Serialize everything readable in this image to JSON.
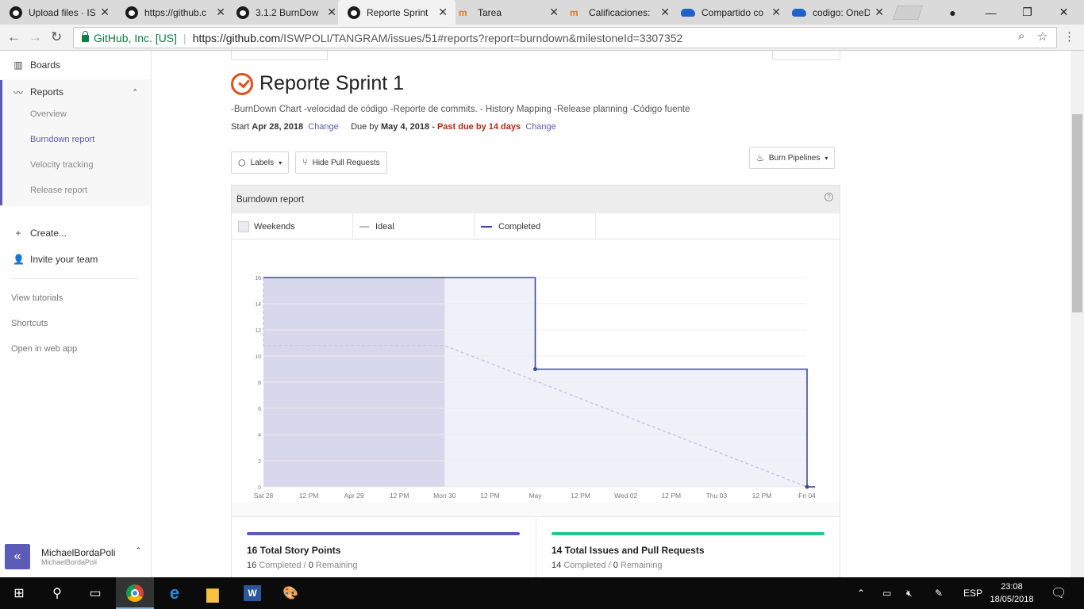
{
  "browser": {
    "tabs": [
      {
        "icon": "github",
        "title": "Upload files · IS"
      },
      {
        "icon": "github",
        "title": "https://github.c"
      },
      {
        "icon": "github",
        "title": "3.1.2 BurnDow"
      },
      {
        "icon": "github",
        "title": "Reporte Sprint",
        "active": true
      },
      {
        "icon": "moodle",
        "title": "Tarea"
      },
      {
        "icon": "moodle",
        "title": "Calificaciones: "
      },
      {
        "icon": "onedrive",
        "title": "Compartido co"
      },
      {
        "icon": "onedrive",
        "title": "codigo: OneDri"
      }
    ],
    "security_label": "GitHub, Inc. [US]",
    "url_host": "https://github.com",
    "url_rest": "/ISWPOLI/TANGRAM/issues/51#reports?report=burndown&milestoneId=3307352"
  },
  "sidebar": {
    "boards": "Boards",
    "reports": "Reports",
    "report_items": [
      "Overview",
      "Burndown report",
      "Velocity tracking",
      "Release report"
    ],
    "create": "Create...",
    "invite": "Invite your team",
    "links": [
      "View tutorials",
      "Shortcuts",
      "Open in web app"
    ],
    "user_name": "MichaelBordaPoli",
    "user_handle": "MichaelBordaPoli",
    "collapse_glyph": "«"
  },
  "main": {
    "title": "Reporte Sprint 1",
    "description": "-BurnDown Chart  -velocidad de código  -Reporte de commits.  - History Mapping   -Release planning  -Código fuente",
    "start_label": "Start",
    "start_date": "Apr 28, 2018",
    "change_label": "Change",
    "due_label": "Due by",
    "due_date": "May 4, 2018",
    "past_due": "Past due by 14 days",
    "dash": "-",
    "labels_button": "Labels",
    "hide_prs_button": "Hide Pull Requests",
    "burn_pipelines_button": "Burn Pipelines",
    "report_title": "Burndown report",
    "help_glyph": "?",
    "legend": {
      "weekends": "Weekends",
      "ideal": "Ideal",
      "completed": "Completed"
    },
    "stats": [
      {
        "big": "16 Total Story Points",
        "completed": "16",
        "completed_label": "Completed",
        "sep": " / ",
        "remaining": "0",
        "remaining_label": "Remaining",
        "color": "#5b5bb8"
      },
      {
        "big": "14 Total Issues and Pull Requests",
        "completed": "14",
        "completed_label": "Completed",
        "sep": " / ",
        "remaining": "0",
        "remaining_label": "Remaining",
        "color": "#1fc98a"
      }
    ]
  },
  "chart_data": {
    "type": "line",
    "title": "",
    "xlabel": "",
    "ylabel": "",
    "x_ticks": [
      "Sat 28",
      "12 PM",
      "Apr 29",
      "12 PM",
      "Mon 30",
      "12 PM",
      "May",
      "12 PM",
      "Wed 02",
      "12 PM",
      "Thu 03",
      "12 PM",
      "Fri 04"
    ],
    "y_ticks": [
      0,
      2,
      4,
      6,
      8,
      10,
      12,
      14,
      16
    ],
    "ylim": [
      0,
      16
    ],
    "x_unit": "hours since Apr 28, 2018 00:00",
    "xlim": [
      0,
      144
    ],
    "weekend_shading": [
      0,
      48
    ],
    "series": [
      {
        "name": "Ideal",
        "style": "dashed",
        "color": "#c9c9d6",
        "points": [
          [
            0,
            16
          ],
          [
            0,
            10.8
          ],
          [
            48,
            10.8
          ],
          [
            144,
            0
          ]
        ]
      },
      {
        "name": "Completed",
        "style": "solid",
        "color": "#3d4aa3",
        "points": [
          [
            0,
            16
          ],
          [
            72,
            16
          ],
          [
            72,
            9
          ],
          [
            144,
            9
          ],
          [
            144,
            0
          ]
        ]
      }
    ],
    "grid": true
  },
  "taskbar": {
    "language": "ESP",
    "time": "23:08",
    "date": "18/05/2018"
  },
  "colors": {
    "accent": "#5b5bb8",
    "completed": "#3d4aa3",
    "due": "#b42a12",
    "issues": "#1fc98a"
  }
}
